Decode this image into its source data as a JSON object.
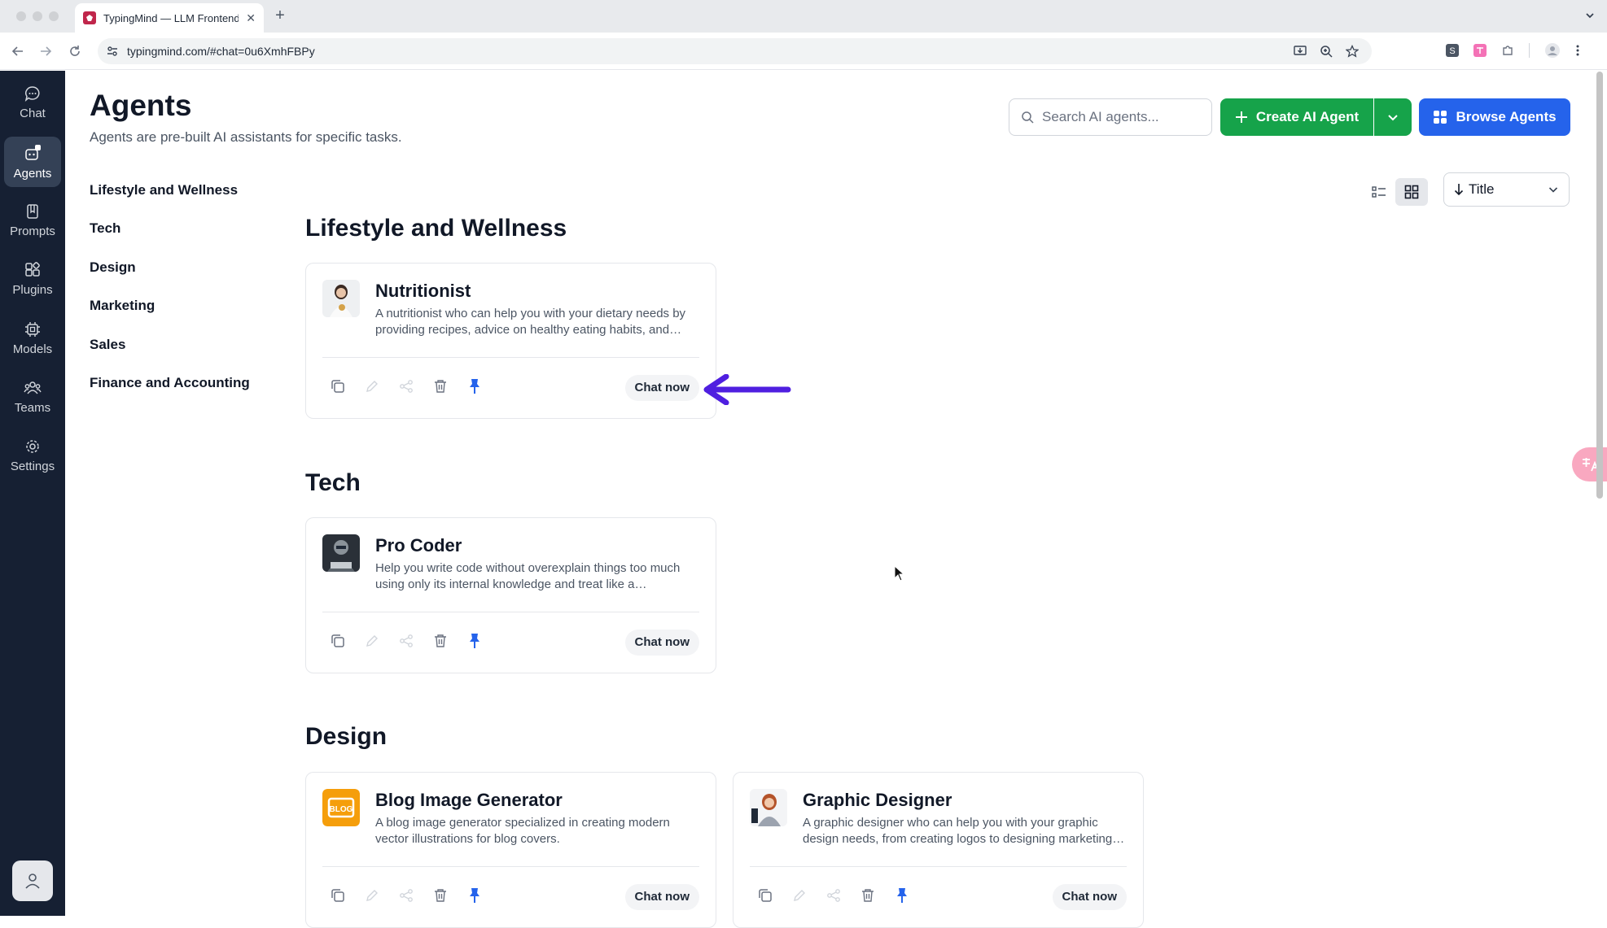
{
  "browser": {
    "tab_title": "TypingMind — LLM Frontend Chat UI",
    "url": "typingmind.com/#chat=0u6XmhFBPy"
  },
  "rail": {
    "items": [
      {
        "label": "Chat",
        "icon": "chat-icon"
      },
      {
        "label": "Agents",
        "icon": "agents-icon",
        "active": true
      },
      {
        "label": "Prompts",
        "icon": "prompts-icon"
      },
      {
        "label": "Plugins",
        "icon": "plugins-icon"
      },
      {
        "label": "Models",
        "icon": "models-icon"
      },
      {
        "label": "Teams",
        "icon": "teams-icon"
      },
      {
        "label": "Settings",
        "icon": "settings-icon"
      }
    ]
  },
  "header": {
    "title": "Agents",
    "subtitle": "Agents are pre-built AI assistants for specific tasks.",
    "search_placeholder": "Search AI agents...",
    "create_label": "Create AI Agent",
    "browse_label": "Browse Agents"
  },
  "categories": [
    "Lifestyle and Wellness",
    "Tech",
    "Design",
    "Marketing",
    "Sales",
    "Finance and Accounting"
  ],
  "sort": {
    "label": "Title"
  },
  "sections": [
    {
      "title": "Lifestyle and Wellness",
      "agents": [
        {
          "name": "Nutritionist",
          "description": "A nutritionist who can help you with your dietary needs by providing recipes, advice on healthy eating habits, and more.",
          "chat_label": "Chat now"
        }
      ]
    },
    {
      "title": "Tech",
      "agents": [
        {
          "name": "Pro Coder",
          "description": "Help you write code without overexplain things too much using only its internal knowledge and treat like a professional.",
          "chat_label": "Chat now"
        }
      ]
    },
    {
      "title": "Design",
      "agents": [
        {
          "name": "Blog Image Generator",
          "description": "A blog image generator specialized in creating modern vector illustrations for blog covers.",
          "chat_label": "Chat now"
        },
        {
          "name": "Graphic Designer",
          "description": "A graphic designer who can help you with your graphic design needs, from creating logos to designing marketing materials.",
          "chat_label": "Chat now"
        }
      ]
    }
  ],
  "colors": {
    "rail_bg": "#162033",
    "create_green": "#16a34a",
    "browse_blue": "#2563eb",
    "pin_blue": "#2563eb",
    "annotation_arrow": "#4f1fe0"
  }
}
